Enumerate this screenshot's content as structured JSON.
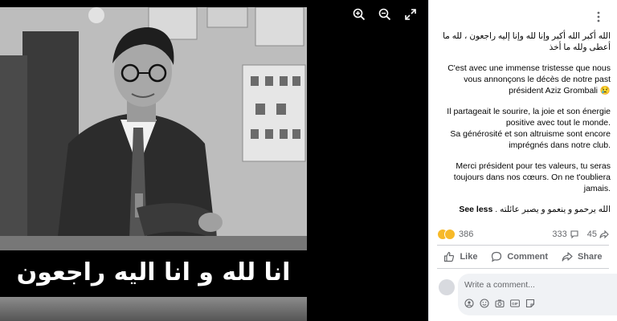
{
  "viewer": {
    "caption": "انا لله و انا اليه راجعون",
    "zoom_in_icon": "zoom-in-icon",
    "zoom_out_icon": "zoom-out-icon",
    "fullscreen_icon": "fullscreen-icon"
  },
  "post": {
    "more_icon": "more-dots-icon",
    "paragraphs": [
      "الله أكبر الله أكبر وإنا لله وإنا إليه راجعون ، لله ما أعطى ولله ما أخذ",
      "C'est avec une immense tristesse que nous vous annonçons le décès de notre past président Aziz Grombali 😢",
      "Il partageait le sourire, la joie et son énergie positive avec tout le monde.",
      "Sa générosité et son altruisme sont encore imprégnés dans notre club.",
      "Merci président pour tes valeurs, tu seras toujours dans nos cœurs. On ne t'oubliera jamais."
    ],
    "closing": "الله يرحمو و ينعمو و يصبر عائلته .",
    "see_less": "See less"
  },
  "reactions": {
    "count": "386",
    "comments": "333",
    "shares": "45",
    "colors": {
      "like_blue": "#1877f2",
      "sad_yellow": "#f7b928",
      "love_red": "#f33e58"
    }
  },
  "actions": {
    "like": "Like",
    "comment": "Comment",
    "share": "Share"
  },
  "composer": {
    "placeholder": "Write a comment...",
    "tools": [
      "avatar-sticker-icon",
      "emoji-icon",
      "camera-icon",
      "gif-icon",
      "sticker-icon"
    ],
    "send_icon": "send-icon"
  }
}
